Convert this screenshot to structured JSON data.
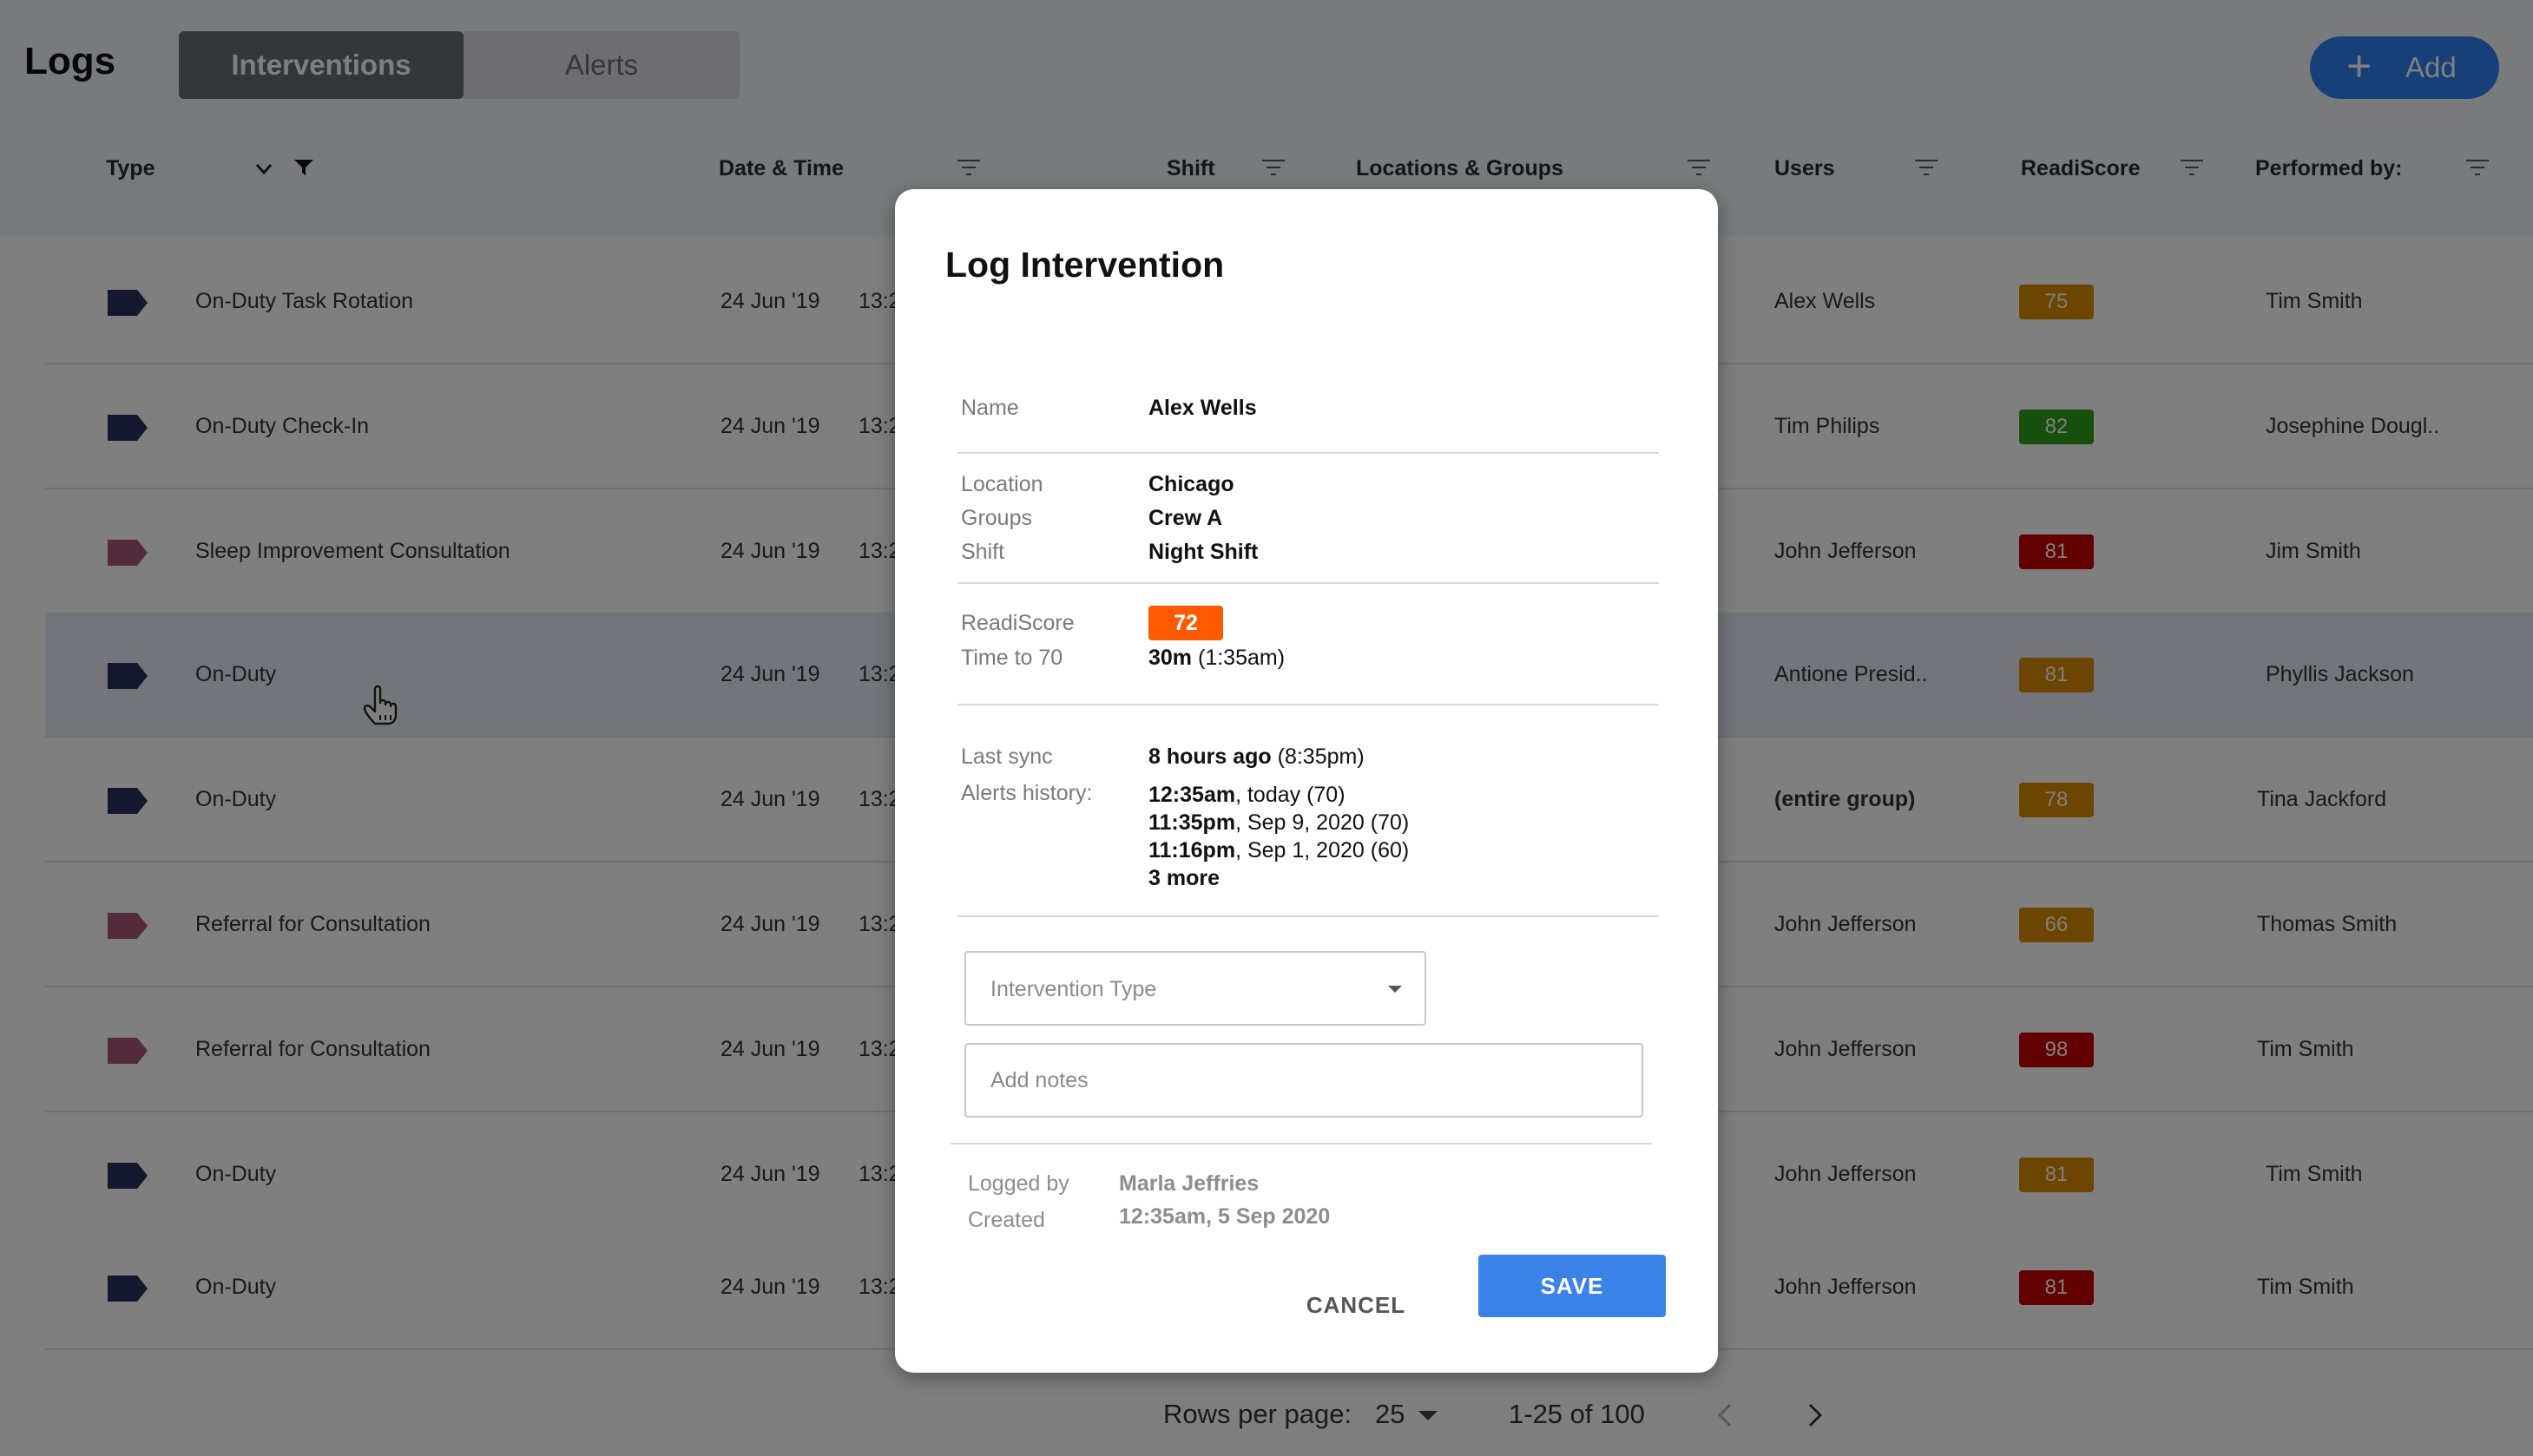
{
  "header": {
    "title": "Logs",
    "tabs": [
      {
        "label": "Interventions",
        "active": true
      },
      {
        "label": "Alerts",
        "active": false
      }
    ],
    "add_button": {
      "label": "Add",
      "icon": "plus-icon"
    }
  },
  "columns": {
    "type": "Type",
    "datetime": "Date & Time",
    "shift": "Shift",
    "locations": "Locations & Groups",
    "users": "Users",
    "readiscore": "ReadiScore",
    "performed_by": "Performed by:"
  },
  "tag_colors": {
    "blue": "#27315f",
    "pink": "#a8577b"
  },
  "rows": [
    {
      "type": "On-Duty Task Rotation",
      "tag": "blue",
      "date": "24 Jun '19",
      "time": "13:2",
      "user": "Alex Wells",
      "score": "75",
      "score_color": "#d98a00",
      "performer": "Tim Smith"
    },
    {
      "type": "On-Duty Check-In",
      "tag": "blue",
      "date": "24 Jun '19",
      "time": "13:2",
      "user": "Tim Philips",
      "score": "82",
      "score_color": "#2e9e1a",
      "performer": "Josephine Dougl.."
    },
    {
      "type": "Sleep Improvement Consultation",
      "tag": "pink",
      "date": "24 Jun '19",
      "time": "13:2",
      "user": "John Jefferson",
      "score": "81",
      "score_color": "#c40000",
      "performer": "Jim Smith"
    },
    {
      "type": "On-Duty",
      "tag": "blue",
      "date": "24 Jun '19",
      "time": "13:2",
      "user": "Antione Presid..",
      "score": "81",
      "score_color": "#d98a00",
      "performer": "Phyllis Jackson"
    },
    {
      "type": "On-Duty",
      "tag": "blue",
      "date": "24 Jun '19",
      "time": "13:2",
      "user": "(entire group)",
      "score": "78",
      "score_color": "#d98a00",
      "performer": "Tina Jackford"
    },
    {
      "type": "Referral for Consultation",
      "tag": "pink",
      "date": "24 Jun '19",
      "time": "13:2",
      "user": "John Jefferson",
      "score": "66",
      "score_color": "#d98a00",
      "performer": "Thomas Smith"
    },
    {
      "type": "Referral for Consultation",
      "tag": "pink",
      "date": "24 Jun '19",
      "time": "13:2",
      "user": "John Jefferson",
      "score": "98",
      "score_color": "#c40000",
      "performer": "Tim Smith"
    },
    {
      "type": "On-Duty",
      "tag": "blue",
      "date": "24 Jun '19",
      "time": "13:2",
      "user": "John Jefferson",
      "score": "81",
      "score_color": "#d98a00",
      "performer": "Tim Smith"
    },
    {
      "type": "On-Duty",
      "tag": "blue",
      "date": "24 Jun '19",
      "time": "13:2",
      "user": "John Jefferson",
      "score": "81",
      "score_color": "#c40000",
      "performer": "Tim Smith"
    }
  ],
  "pagination": {
    "rows_per_page_label": "Rows per page:",
    "rows_per_page": "25",
    "range": "1-25 of 100"
  },
  "modal": {
    "title": "Log Intervention",
    "name_label": "Name",
    "name": "Alex Wells",
    "location_label": "Location",
    "location": "Chicago",
    "groups_label": "Groups",
    "groups": "Crew A",
    "shift_label": "Shift",
    "shift": "Night Shift",
    "readiscore_label": "ReadiScore",
    "readiscore": "72",
    "readiscore_color": "#ff5a00",
    "time_to_label": "Time to 70",
    "time_to_bold": "30m",
    "time_to_rest": " (1:35am)",
    "last_sync_label": "Last sync",
    "last_sync_bold": "8 hours ago",
    "last_sync_rest": " (8:35pm)",
    "alerts_label": "Alerts history:",
    "alerts": [
      {
        "bold": "12:35am",
        "rest": ", today (70)"
      },
      {
        "bold": "11:35pm",
        "rest": ", Sep 9, 2020 (70)"
      },
      {
        "bold": "11:16pm",
        "rest": ", Sep 1, 2020 (60)"
      }
    ],
    "alerts_more": "3 more",
    "intervention_type_placeholder": "Intervention Type",
    "notes_placeholder": "Add notes",
    "logged_by_label": "Logged by",
    "logged_by": "Marla Jeffries",
    "created_label": "Created",
    "created": "12:35am, 5 Sep 2020",
    "cancel_label": "CANCEL",
    "save_label": "SAVE"
  }
}
